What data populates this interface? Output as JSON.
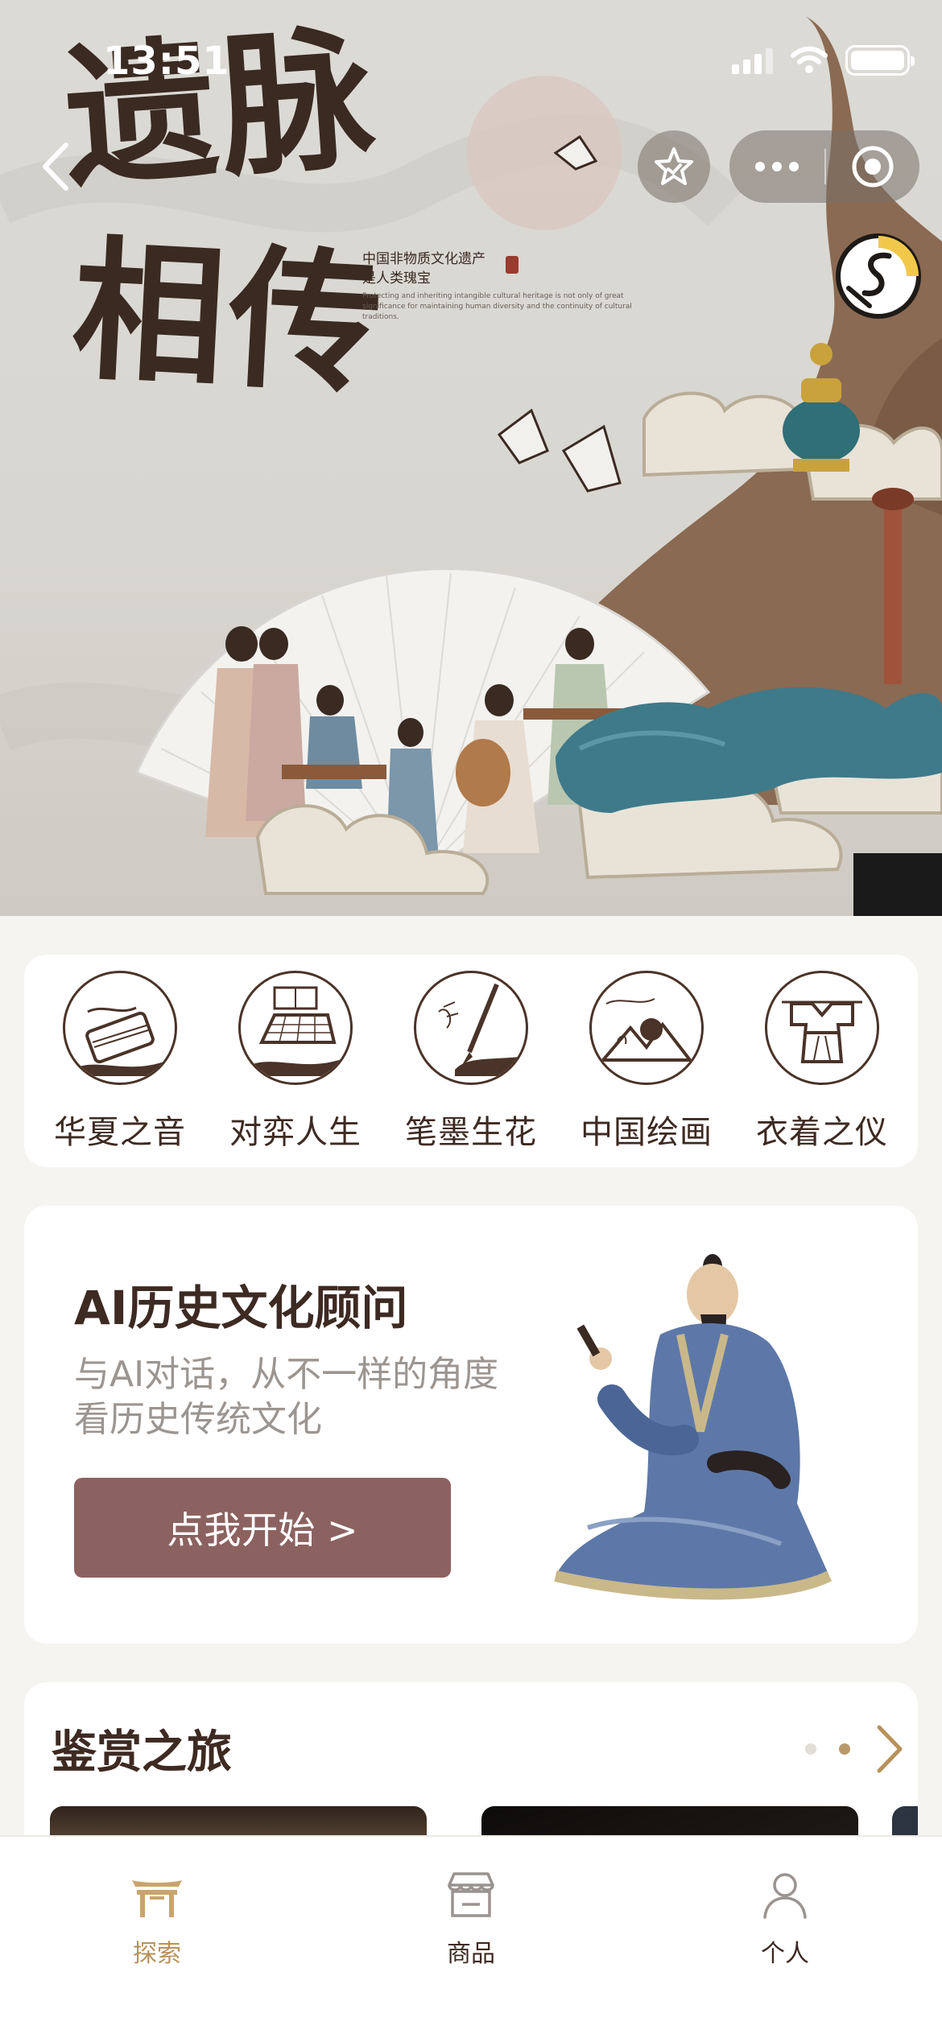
{
  "status_bar": {
    "time": "13:51"
  },
  "hero": {
    "title_line1": "遗脉",
    "title_line2": "相传",
    "subtitle_line1": "中国非物质文化遗产",
    "subtitle_line2": "是人类瑰宝",
    "subtitle_en": "Protecting and inheriting intangible cultural heritage is not only of great significance for maintaining human diversity and the continuity of cultural traditions."
  },
  "nav": {
    "back_icon": "chevron-left-icon",
    "favorite_icon": "star-icon",
    "more_icon": "more-dots-icon",
    "close_icon": "target-circle-icon",
    "audio_icon": "music-disc-icon"
  },
  "categories": [
    {
      "label": "华夏之音",
      "icon": "guqin-icon"
    },
    {
      "label": "对弈人生",
      "icon": "go-board-icon"
    },
    {
      "label": "笔墨生花",
      "icon": "brush-icon"
    },
    {
      "label": "中国绘画",
      "icon": "landscape-painting-icon"
    },
    {
      "label": "衣着之仪",
      "icon": "hanfu-icon"
    }
  ],
  "ai_card": {
    "title": "AI历史文化顾问",
    "description": "与AI对话，从不一样的角度看历史传统文化",
    "button_label": "点我开始 >"
  },
  "journey": {
    "title": "鉴赏之旅",
    "page_count": 2,
    "active_page": 2
  },
  "tabbar": [
    {
      "label": "探索",
      "icon": "pavilion-icon",
      "active": true
    },
    {
      "label": "商品",
      "icon": "shop-icon",
      "active": false
    },
    {
      "label": "个人",
      "icon": "person-icon",
      "active": false
    }
  ],
  "colors": {
    "brand_brown": "#3d2a22",
    "button_mauve": "#8c6260",
    "accent_gold": "#b8925a",
    "page_bg": "#f6f4f1"
  }
}
